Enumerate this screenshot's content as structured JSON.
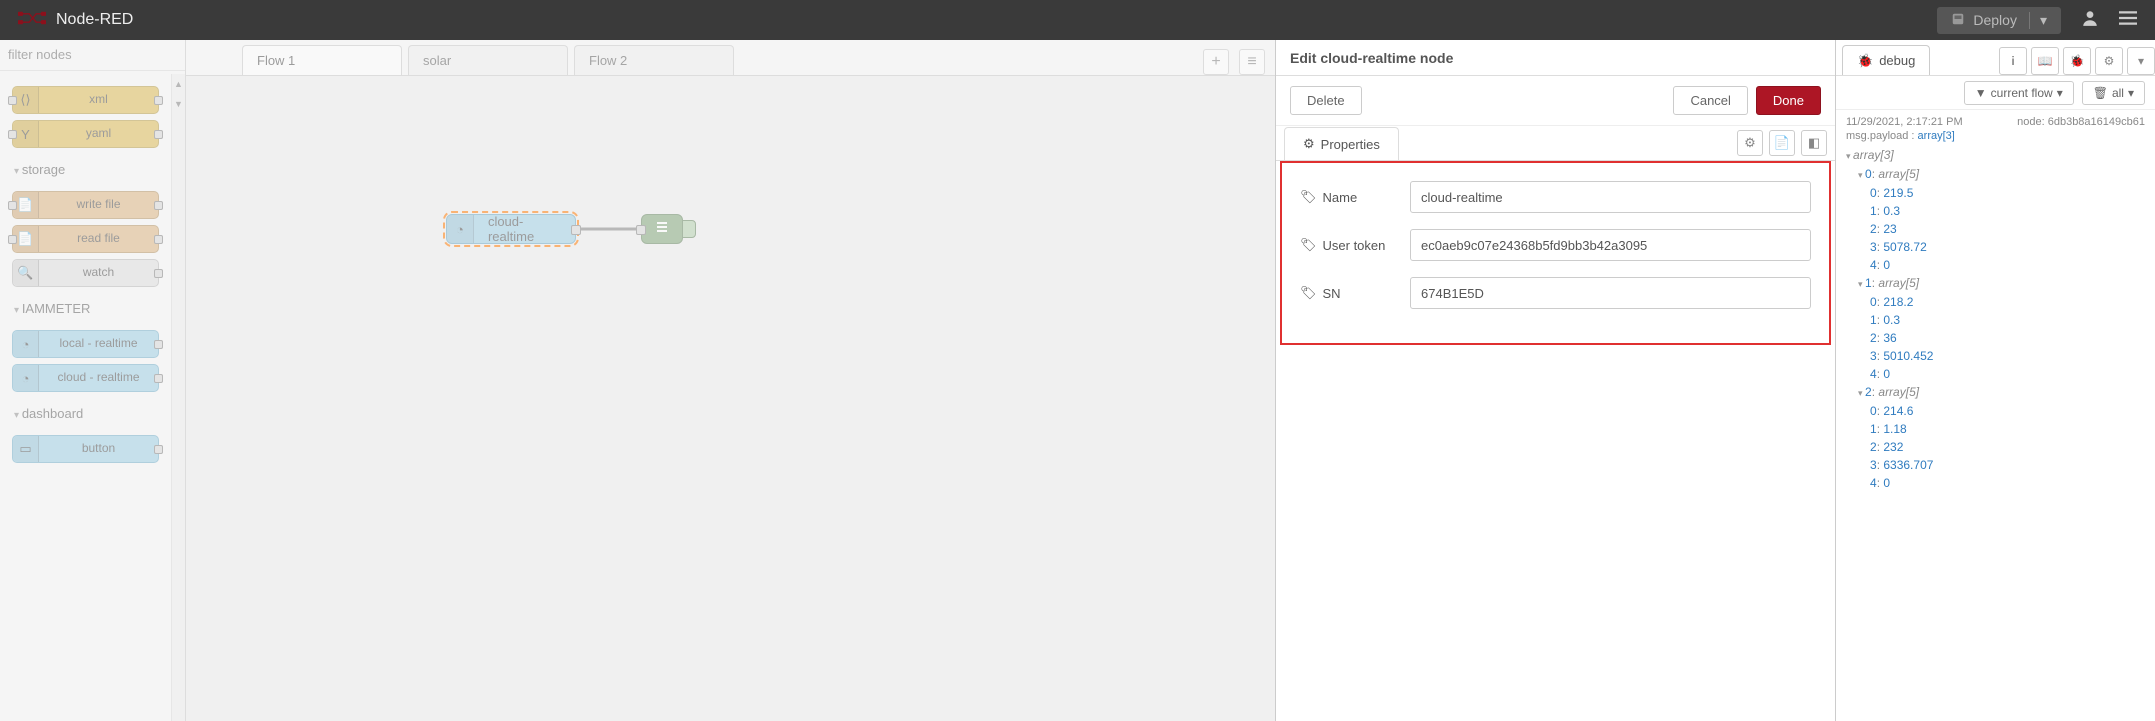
{
  "header": {
    "title": "Node-RED",
    "deploy_label": "Deploy"
  },
  "palette": {
    "filter_placeholder": "filter nodes",
    "nodes_top": [
      {
        "label": "xml"
      },
      {
        "label": "yaml"
      }
    ],
    "cat_storage": "storage",
    "nodes_storage": [
      {
        "label": "write file"
      },
      {
        "label": "read file"
      },
      {
        "label": "watch"
      }
    ],
    "cat_iam": "IAMMETER",
    "nodes_iam": [
      {
        "label": "local - realtime"
      },
      {
        "label": "cloud - realtime"
      }
    ],
    "cat_dash": "dashboard",
    "nodes_dash": [
      {
        "label": "button"
      }
    ]
  },
  "tabs": [
    {
      "label": "Flow 1",
      "active": true
    },
    {
      "label": "solar"
    },
    {
      "label": "Flow 2"
    }
  ],
  "flow": {
    "node_label": "cloud-realtime"
  },
  "tray": {
    "title": "Edit cloud-realtime node",
    "delete_label": "Delete",
    "cancel_label": "Cancel",
    "done_label": "Done",
    "tab_label": "Properties",
    "fields": {
      "name_label": "Name",
      "name_value": "cloud-realtime",
      "token_label": "User token",
      "token_value": "ec0aeb9c07e24368b5fd9bb3b42a3095",
      "sn_label": "SN",
      "sn_value": "674B1E5D"
    }
  },
  "sidebar": {
    "tab_label": "debug",
    "filter_label": "current flow",
    "clear_label": "all",
    "msg": {
      "time": "11/29/2021, 2:17:21 PM",
      "node": "node: 6db3b8a16149cb61",
      "topic": "msg.payload",
      "type": "array[3]",
      "root": "array[3]",
      "items": [
        {
          "label": "0",
          "type": "array[5]",
          "vals": [
            "219.5",
            "0.3",
            "23",
            "5078.72",
            "0"
          ]
        },
        {
          "label": "1",
          "type": "array[5]",
          "vals": [
            "218.2",
            "0.3",
            "36",
            "5010.452",
            "0"
          ]
        },
        {
          "label": "2",
          "type": "array[5]",
          "vals": [
            "214.6",
            "1.18",
            "232",
            "6336.707",
            "0"
          ]
        }
      ]
    }
  }
}
